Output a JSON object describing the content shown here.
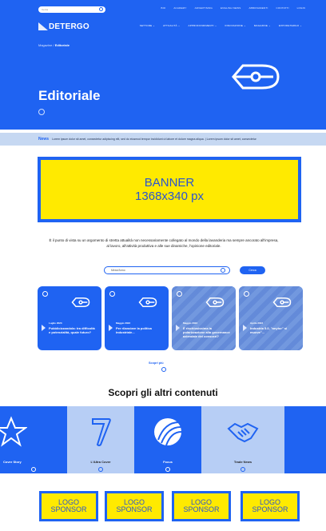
{
  "header": {
    "search_placeholder": "Cerca",
    "top_links": [
      "BIO",
      "ACADEMY",
      "ADVERTISING",
      "ENGLISH NEWS",
      "ABBONAMENTI",
      "CONTATTI",
      "LOGIN"
    ],
    "brand": "DETERGO",
    "nav": [
      "SETTORE",
      "ATTUALITÀ",
      "APPROFONDIMENTI",
      "INNOVAZIONE",
      "MAGAZINE",
      "EXPODETERGO"
    ]
  },
  "hero": {
    "breadcrumb_parent": "Magazine",
    "breadcrumb_sep": " / ",
    "breadcrumb_current": "Editoriale",
    "title": "Editoriale"
  },
  "ticker": {
    "label": "News",
    "text": "Lorem ipsum dolor sit amet, consectetur adipiscing elit, sed do eiusmod tempor incididunt ut labore et dolore magna aliqua. | Lorem ipsum dolor sit amet, consectetur"
  },
  "banner": {
    "line1": "BANNER",
    "line2": "1368x340 px"
  },
  "intro": {
    "text": "È il punto di vista su un argomento di stretta attualità non necessariamente collegato al mondo della lavanderia ma sempre ancorato all'impresa, al lavoro, all'attività produttiva e alle sue dinamiche, l'opinione editoriale."
  },
  "archive_search": {
    "placeholder": "Mese/Anno",
    "button": "Cerca"
  },
  "cards": [
    {
      "date": "Luglio 2023",
      "title": "Pubblicizzandola: tra difficoltà e potenzialità, quale futuro?"
    },
    {
      "date": "Maggio 2023",
      "title": "Per rilanciare la politica industriale..."
    },
    {
      "date": "Maggio 2023",
      "title": "È rischiosissima la polarizzazione alla governance aziendale dei consorzi?"
    },
    {
      "date": "Aprile 2023",
      "title": "Industria 5.0, \"anytor\" si muove\"..."
    }
  ],
  "discover_more": "Scopri più",
  "other": {
    "heading": "Scopri gli altri contenuti",
    "tiles": [
      {
        "label": "Cover Story",
        "icon": "star-icon"
      },
      {
        "label": "L'Altra Cover",
        "icon": "seven-icon"
      },
      {
        "label": "Focus",
        "icon": "lens-icon"
      },
      {
        "label": "Trade News",
        "icon": "handshake-icon"
      }
    ]
  },
  "sponsors": [
    {
      "line1": "LOGO",
      "line2": "SPONSOR"
    },
    {
      "line1": "LOGO",
      "line2": "SPONSOR"
    },
    {
      "line1": "LOGO",
      "line2": "SPONSOR"
    },
    {
      "line1": "LOGO",
      "line2": "SPONSOR"
    }
  ],
  "colors": {
    "accent": "#1f63f2",
    "banner_fill": "#ffea00",
    "ticker_bg": "#c6d8f2",
    "tile_light": "#b7cef5"
  }
}
